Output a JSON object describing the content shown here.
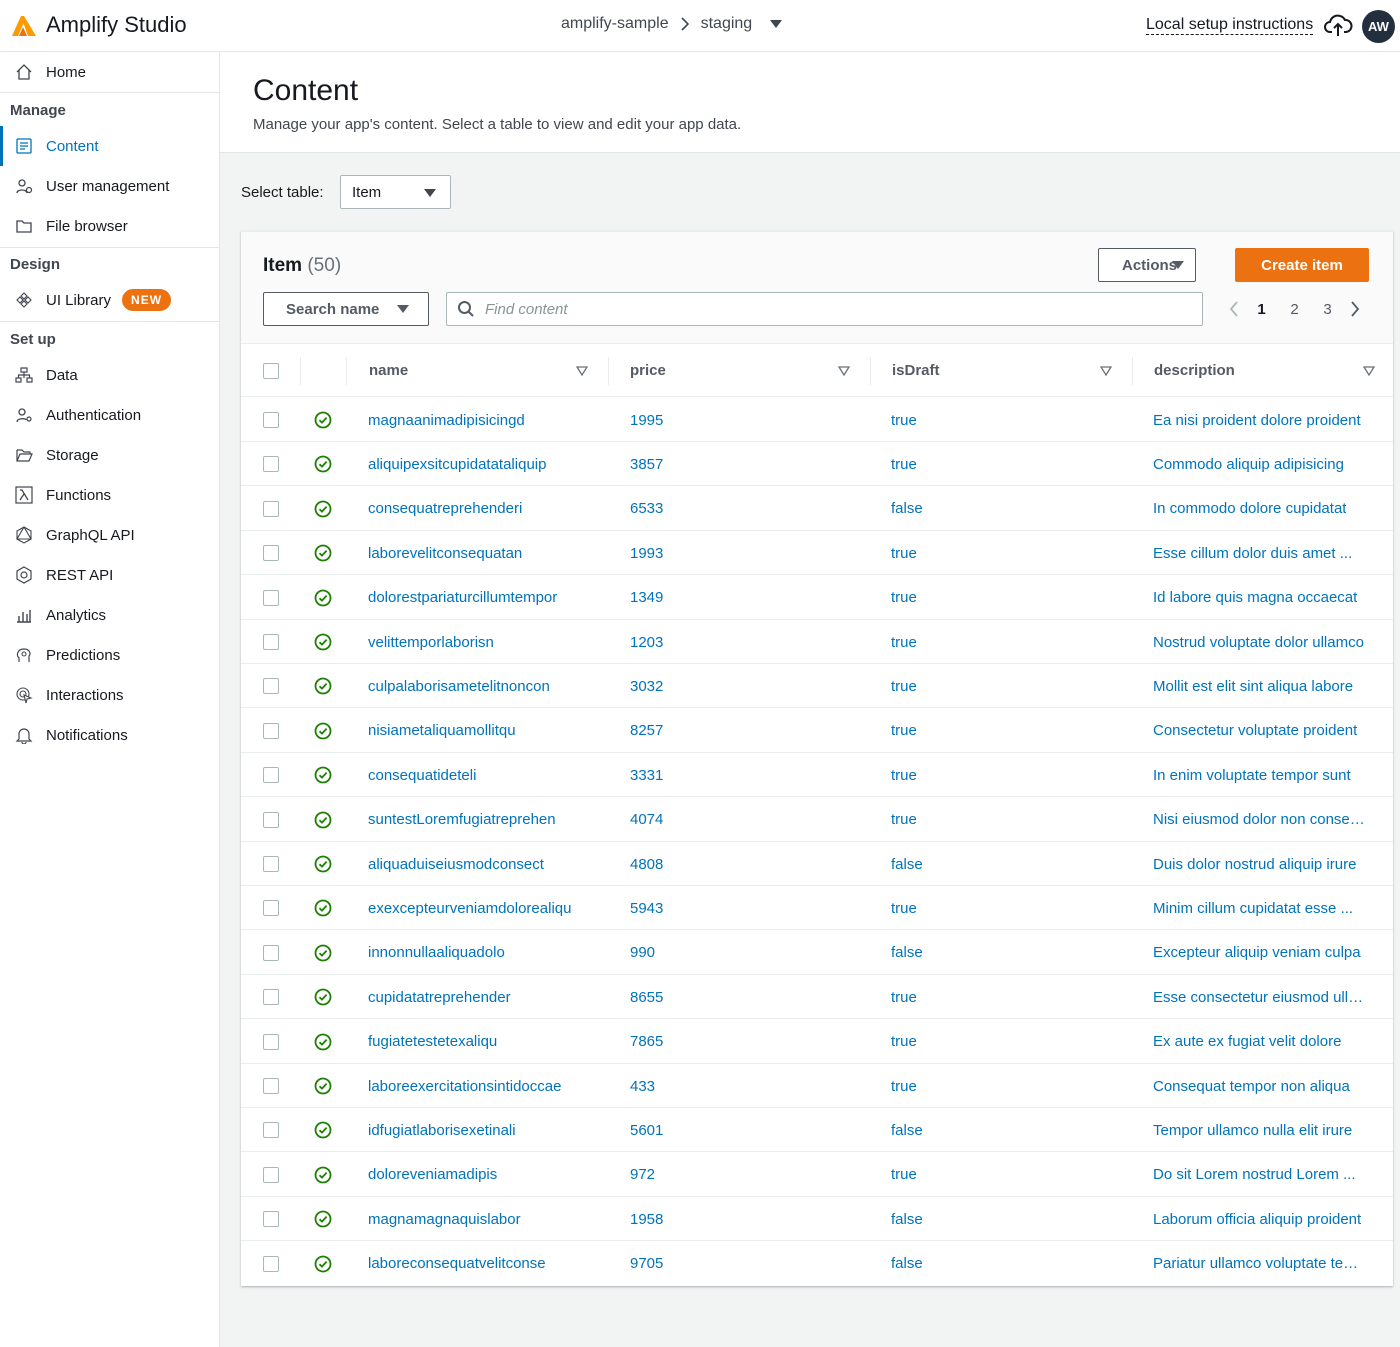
{
  "topbar": {
    "brand": "Amplify Studio",
    "app": "amplify-sample",
    "env": "staging",
    "local_setup": "Local setup instructions",
    "avatar": "AW"
  },
  "sidebar": {
    "home": "Home",
    "sections": {
      "manage": "Manage",
      "design": "Design",
      "setup": "Set up"
    },
    "manage_items": [
      "Content",
      "User management",
      "File browser"
    ],
    "design_items": [
      "UI Library"
    ],
    "new_badge": "NEW",
    "setup_items": [
      "Data",
      "Authentication",
      "Storage",
      "Functions",
      "GraphQL API",
      "REST API",
      "Analytics",
      "Predictions",
      "Interactions",
      "Notifications"
    ]
  },
  "page": {
    "title": "Content",
    "subtitle": "Manage your app's content. Select a table to view and edit your app data.",
    "select_label": "Select table:",
    "select_value": "Item"
  },
  "panel": {
    "title": "Item",
    "count": "(50)",
    "actions_label": "Actions",
    "create_label": "Create item",
    "search_by": "Search name",
    "find_placeholder": "Find content",
    "pages": [
      "1",
      "2",
      "3"
    ],
    "current_page": "1"
  },
  "table": {
    "columns": [
      "name",
      "price",
      "isDraft",
      "description"
    ],
    "rows": [
      {
        "name": "magnaanimadipisicingd",
        "price": "1995",
        "isDraft": "true",
        "description": "Ea nisi proident dolore proident"
      },
      {
        "name": "aliquipexsitcupidatataliquip",
        "price": "3857",
        "isDraft": "true",
        "description": "Commodo aliquip adipisicing"
      },
      {
        "name": "consequatreprehenderi",
        "price": "6533",
        "isDraft": "false",
        "description": "In commodo dolore cupidatat"
      },
      {
        "name": "laborevelitconsequatan",
        "price": "1993",
        "isDraft": "true",
        "description": "Esse cillum dolor duis amet ..."
      },
      {
        "name": "dolorestpariaturcillumtempor",
        "price": "1349",
        "isDraft": "true",
        "description": "Id labore quis magna occaecat"
      },
      {
        "name": "velittemporlaborisn",
        "price": "1203",
        "isDraft": "true",
        "description": "Nostrud voluptate dolor ullamco"
      },
      {
        "name": "culpalaborisametelitnoncon",
        "price": "3032",
        "isDraft": "true",
        "description": "Mollit est elit sint aliqua labore"
      },
      {
        "name": "nisiametaliquamollitqu",
        "price": "8257",
        "isDraft": "true",
        "description": "Consectetur voluptate proident"
      },
      {
        "name": "consequatideteli",
        "price": "3331",
        "isDraft": "true",
        "description": "In enim voluptate tempor sunt"
      },
      {
        "name": "suntestLoremfugiatreprehen",
        "price": "4074",
        "isDraft": "true",
        "description": "Nisi eiusmod dolor non consequat"
      },
      {
        "name": "aliquaduiseiusmodconsect",
        "price": "4808",
        "isDraft": "false",
        "description": "Duis dolor nostrud aliquip irure"
      },
      {
        "name": "exexcepteurveniamdolorealiqu",
        "price": "5943",
        "isDraft": "true",
        "description": "Minim cillum cupidatat esse ..."
      },
      {
        "name": "innonnullaaliquadolo",
        "price": "990",
        "isDraft": "false",
        "description": "Excepteur aliquip veniam culpa"
      },
      {
        "name": "cupidatatreprehender",
        "price": "8655",
        "isDraft": "true",
        "description": "Esse consectetur eiusmod ullamco"
      },
      {
        "name": "fugiatetestetexaliqu",
        "price": "7865",
        "isDraft": "true",
        "description": "Ex aute ex fugiat velit dolore"
      },
      {
        "name": "laboreexercitationsintidoccae",
        "price": "433",
        "isDraft": "true",
        "description": "Consequat tempor non aliqua"
      },
      {
        "name": "idfugiatlaborisexetinali",
        "price": "5601",
        "isDraft": "false",
        "description": "Tempor ullamco nulla elit irure"
      },
      {
        "name": "doloreveniamadipis",
        "price": "972",
        "isDraft": "true",
        "description": "Do sit Lorem nostrud Lorem ..."
      },
      {
        "name": "magnamagnaquislabor",
        "price": "1958",
        "isDraft": "false",
        "description": "Laborum officia aliquip proident"
      },
      {
        "name": "laboreconsequatvelitconse",
        "price": "9705",
        "isDraft": "false",
        "description": "Pariatur ullamco voluptate tempor"
      }
    ]
  },
  "colors": {
    "accent": "#0073bb",
    "primary_button": "#ec7211",
    "success": "#1d8102"
  }
}
